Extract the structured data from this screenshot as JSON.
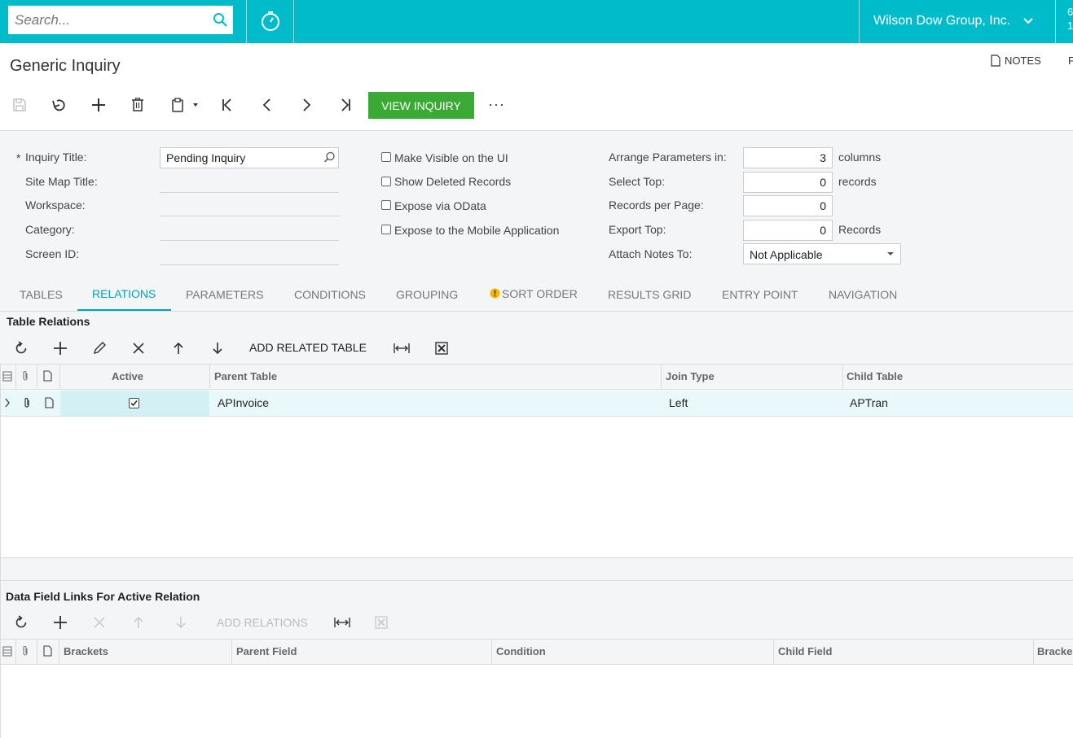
{
  "topbar": {
    "search_placeholder": "Search...",
    "company": "Wilson Dow Group, Inc.",
    "right_cut": "6\n1"
  },
  "header": {
    "title": "Generic Inquiry",
    "notes": "NOTES",
    "f_cut": "F",
    "view_inquiry": "VIEW INQUIRY",
    "more": "···"
  },
  "form": {
    "required_mark": "*",
    "inquiry_title_label": "Inquiry Title:",
    "inquiry_title_value": "Pending Inquiry",
    "site_map_title_label": "Site Map Title:",
    "workspace_label": "Workspace:",
    "category_label": "Category:",
    "screen_id_label": "Screen ID:",
    "checkboxes": [
      {
        "label": "Make Visible on the UI",
        "checked": false
      },
      {
        "label": "Show Deleted Records",
        "checked": false
      },
      {
        "label": "Expose via OData",
        "checked": false
      },
      {
        "label": "Expose to the Mobile Application",
        "checked": false
      }
    ],
    "arrange_label": "Arrange Parameters in:",
    "arrange_value": "3",
    "arrange_unit": "columns",
    "select_top_label": "Select Top:",
    "select_top_value": "0",
    "select_top_unit": "records",
    "records_per_page_label": "Records per Page:",
    "records_per_page_value": "0",
    "export_top_label": "Export Top:",
    "export_top_value": "0",
    "export_top_unit": "Records",
    "attach_notes_label": "Attach Notes To:",
    "attach_notes_value": "Not Applicable"
  },
  "tabs": [
    "TABLES",
    "RELATIONS",
    "PARAMETERS",
    "CONDITIONS",
    "GROUPING",
    "SORT ORDER",
    "RESULTS GRID",
    "ENTRY POINT",
    "NAVIGATION"
  ],
  "active_tab": "RELATIONS",
  "relations": {
    "title": "Table Relations",
    "add_label": "ADD RELATED TABLE",
    "columns": [
      "Active",
      "Parent Table",
      "Join Type",
      "Child Table"
    ],
    "rows": [
      {
        "active": true,
        "parent_table": "APInvoice",
        "join_type": "Left",
        "child_table": "APTran"
      }
    ]
  },
  "links": {
    "title": "Data Field Links For Active Relation",
    "add_label": "ADD RELATIONS",
    "columns": [
      "Brackets",
      "Parent Field",
      "Condition",
      "Child Field",
      "Bracke"
    ]
  },
  "colors": {
    "accent": "#00BCCB",
    "primary_button": "#3AAA35",
    "tab_active": "#00A3B4",
    "warning": "#F5B800"
  }
}
